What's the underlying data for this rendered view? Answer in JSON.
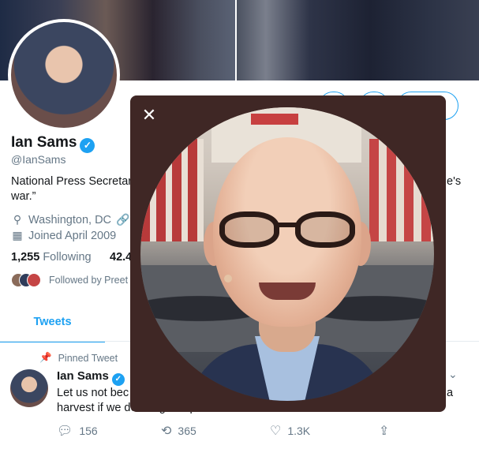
{
  "profile": {
    "name": "Ian Sams",
    "handle": "@IanSams",
    "bio_line1": "National Press Secretar",
    "bio_tail": "e's",
    "bio_line2": "war.”",
    "location": "Washington, DC",
    "joined": "Joined April 2009",
    "following_count": "1,255",
    "following_label": "Following",
    "followers_count": "42.4",
    "followed_by": "Followed by Preet"
  },
  "tabs": {
    "tweets": "Tweets"
  },
  "pinned_tweet": {
    "pinned_label": "Pinned Tweet",
    "author": "Ian Sams",
    "text_line1": "Let us not bec",
    "text_line1_tail": "a",
    "text_line2": "harvest if we do not give up.",
    "replies": "156",
    "retweets": "365",
    "likes": "1.3K"
  },
  "icons": {
    "close": "close-icon",
    "verified": "verified-badge-icon",
    "location": "location-pin-icon",
    "link": "link-icon",
    "calendar": "calendar-icon",
    "pin": "pin-icon",
    "reply": "reply-icon",
    "retweet": "retweet-icon",
    "like": "heart-icon",
    "share": "share-icon",
    "chevron": "chevron-down-icon"
  },
  "colors": {
    "accent": "#1da1f2",
    "modal": "#3f2725"
  }
}
